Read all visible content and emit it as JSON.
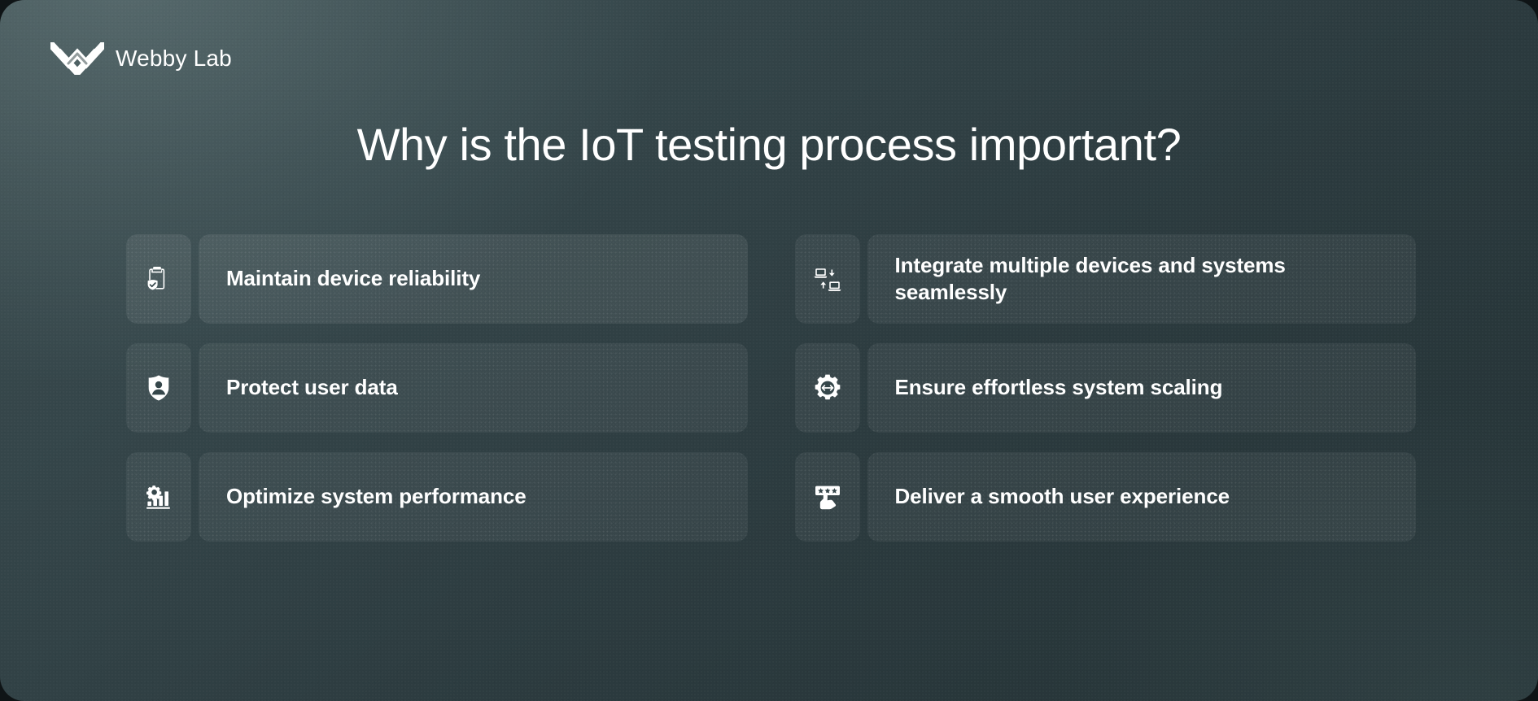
{
  "brand": {
    "name": "Webby Lab",
    "logo_icon": "webby-lab-chevron-logo",
    "color": "#ffffff"
  },
  "header": {
    "title": "Why is the IoT testing process important?"
  },
  "theme": {
    "background_start": "#3b4b4e",
    "background_end": "#243235",
    "card_background": "rgba(255,255,255,0.055)",
    "text_color": "#ffffff"
  },
  "benefits": {
    "left_column": [
      {
        "label": "Maintain device reliability",
        "icon": "clipboard-shield-check-icon"
      },
      {
        "label": "Protect user data",
        "icon": "shield-user-icon"
      },
      {
        "label": "Optimize system performance",
        "icon": "gear-bar-chart-icon"
      }
    ],
    "right_column": [
      {
        "label": "Integrate multiple devices and systems seamlessly",
        "icon": "two-laptops-sync-icon"
      },
      {
        "label": "Ensure effortless system scaling",
        "icon": "gear-resize-arrows-icon"
      },
      {
        "label": "Deliver a smooth user experience",
        "icon": "hand-star-rating-icon"
      }
    ]
  }
}
